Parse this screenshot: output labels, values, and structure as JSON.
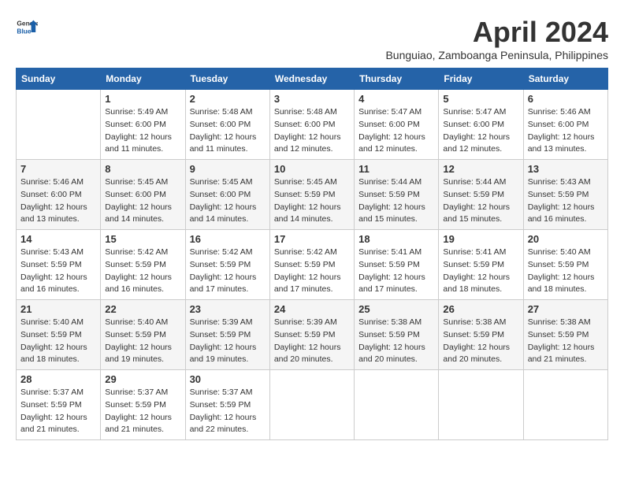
{
  "header": {
    "logo_general": "General",
    "logo_blue": "Blue",
    "month_title": "April 2024",
    "location": "Bunguiao, Zamboanga Peninsula, Philippines"
  },
  "weekdays": [
    "Sunday",
    "Monday",
    "Tuesday",
    "Wednesday",
    "Thursday",
    "Friday",
    "Saturday"
  ],
  "weeks": [
    [
      {
        "day": "",
        "info": ""
      },
      {
        "day": "1",
        "info": "Sunrise: 5:49 AM\nSunset: 6:00 PM\nDaylight: 12 hours\nand 11 minutes."
      },
      {
        "day": "2",
        "info": "Sunrise: 5:48 AM\nSunset: 6:00 PM\nDaylight: 12 hours\nand 11 minutes."
      },
      {
        "day": "3",
        "info": "Sunrise: 5:48 AM\nSunset: 6:00 PM\nDaylight: 12 hours\nand 12 minutes."
      },
      {
        "day": "4",
        "info": "Sunrise: 5:47 AM\nSunset: 6:00 PM\nDaylight: 12 hours\nand 12 minutes."
      },
      {
        "day": "5",
        "info": "Sunrise: 5:47 AM\nSunset: 6:00 PM\nDaylight: 12 hours\nand 12 minutes."
      },
      {
        "day": "6",
        "info": "Sunrise: 5:46 AM\nSunset: 6:00 PM\nDaylight: 12 hours\nand 13 minutes."
      }
    ],
    [
      {
        "day": "7",
        "info": "Sunrise: 5:46 AM\nSunset: 6:00 PM\nDaylight: 12 hours\nand 13 minutes."
      },
      {
        "day": "8",
        "info": "Sunrise: 5:45 AM\nSunset: 6:00 PM\nDaylight: 12 hours\nand 14 minutes."
      },
      {
        "day": "9",
        "info": "Sunrise: 5:45 AM\nSunset: 6:00 PM\nDaylight: 12 hours\nand 14 minutes."
      },
      {
        "day": "10",
        "info": "Sunrise: 5:45 AM\nSunset: 5:59 PM\nDaylight: 12 hours\nand 14 minutes."
      },
      {
        "day": "11",
        "info": "Sunrise: 5:44 AM\nSunset: 5:59 PM\nDaylight: 12 hours\nand 15 minutes."
      },
      {
        "day": "12",
        "info": "Sunrise: 5:44 AM\nSunset: 5:59 PM\nDaylight: 12 hours\nand 15 minutes."
      },
      {
        "day": "13",
        "info": "Sunrise: 5:43 AM\nSunset: 5:59 PM\nDaylight: 12 hours\nand 16 minutes."
      }
    ],
    [
      {
        "day": "14",
        "info": "Sunrise: 5:43 AM\nSunset: 5:59 PM\nDaylight: 12 hours\nand 16 minutes."
      },
      {
        "day": "15",
        "info": "Sunrise: 5:42 AM\nSunset: 5:59 PM\nDaylight: 12 hours\nand 16 minutes."
      },
      {
        "day": "16",
        "info": "Sunrise: 5:42 AM\nSunset: 5:59 PM\nDaylight: 12 hours\nand 17 minutes."
      },
      {
        "day": "17",
        "info": "Sunrise: 5:42 AM\nSunset: 5:59 PM\nDaylight: 12 hours\nand 17 minutes."
      },
      {
        "day": "18",
        "info": "Sunrise: 5:41 AM\nSunset: 5:59 PM\nDaylight: 12 hours\nand 17 minutes."
      },
      {
        "day": "19",
        "info": "Sunrise: 5:41 AM\nSunset: 5:59 PM\nDaylight: 12 hours\nand 18 minutes."
      },
      {
        "day": "20",
        "info": "Sunrise: 5:40 AM\nSunset: 5:59 PM\nDaylight: 12 hours\nand 18 minutes."
      }
    ],
    [
      {
        "day": "21",
        "info": "Sunrise: 5:40 AM\nSunset: 5:59 PM\nDaylight: 12 hours\nand 18 minutes."
      },
      {
        "day": "22",
        "info": "Sunrise: 5:40 AM\nSunset: 5:59 PM\nDaylight: 12 hours\nand 19 minutes."
      },
      {
        "day": "23",
        "info": "Sunrise: 5:39 AM\nSunset: 5:59 PM\nDaylight: 12 hours\nand 19 minutes."
      },
      {
        "day": "24",
        "info": "Sunrise: 5:39 AM\nSunset: 5:59 PM\nDaylight: 12 hours\nand 20 minutes."
      },
      {
        "day": "25",
        "info": "Sunrise: 5:38 AM\nSunset: 5:59 PM\nDaylight: 12 hours\nand 20 minutes."
      },
      {
        "day": "26",
        "info": "Sunrise: 5:38 AM\nSunset: 5:59 PM\nDaylight: 12 hours\nand 20 minutes."
      },
      {
        "day": "27",
        "info": "Sunrise: 5:38 AM\nSunset: 5:59 PM\nDaylight: 12 hours\nand 21 minutes."
      }
    ],
    [
      {
        "day": "28",
        "info": "Sunrise: 5:37 AM\nSunset: 5:59 PM\nDaylight: 12 hours\nand 21 minutes."
      },
      {
        "day": "29",
        "info": "Sunrise: 5:37 AM\nSunset: 5:59 PM\nDaylight: 12 hours\nand 21 minutes."
      },
      {
        "day": "30",
        "info": "Sunrise: 5:37 AM\nSunset: 5:59 PM\nDaylight: 12 hours\nand 22 minutes."
      },
      {
        "day": "",
        "info": ""
      },
      {
        "day": "",
        "info": ""
      },
      {
        "day": "",
        "info": ""
      },
      {
        "day": "",
        "info": ""
      }
    ]
  ]
}
